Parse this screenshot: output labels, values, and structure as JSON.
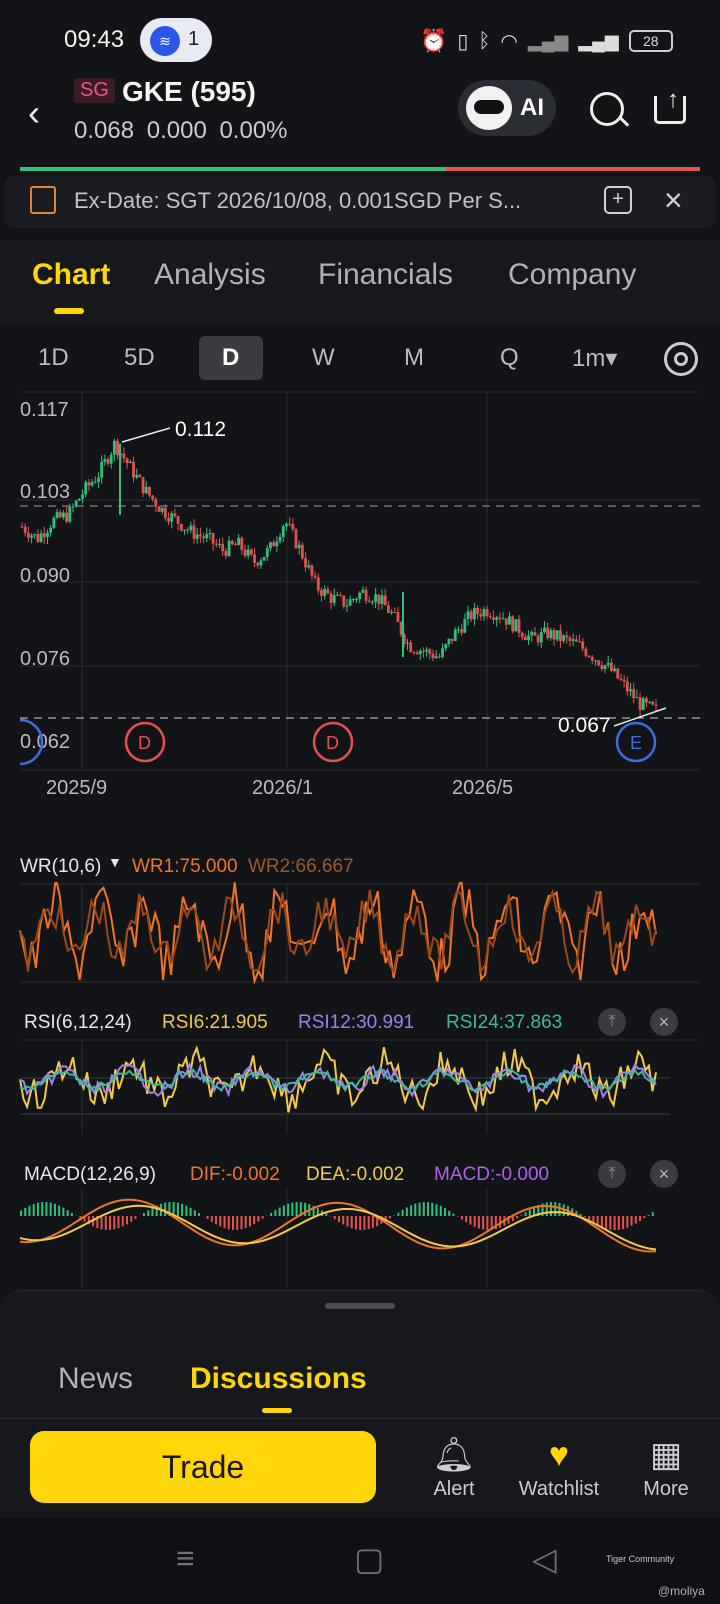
{
  "status": {
    "time": "09:43",
    "notif_count": "1",
    "battery": "28"
  },
  "header": {
    "market": "SG",
    "title": "GKE (595)",
    "quote": "0.068 0.000 0.00%",
    "ai_label": "AI"
  },
  "banner": {
    "text": "Ex-Date: SGT 2026/10/08, 0.001SGD Per S..."
  },
  "tabs": [
    "Chart",
    "Analysis",
    "Financials",
    "Company"
  ],
  "periods": [
    "1D",
    "5D",
    "D",
    "W",
    "M",
    "Q",
    "1m▾"
  ],
  "chart_data": {
    "type": "candlestick",
    "y_ticks": [
      "0.117",
      "0.103",
      "0.090",
      "0.076",
      "0.062"
    ],
    "x_ticks": [
      "2025/9",
      "2026/1",
      "2026/5"
    ],
    "high_label": "0.112",
    "low_label": "0.067",
    "markers": [
      "D",
      "D",
      "E"
    ],
    "price_path": [
      0.098,
      0.096,
      0.099,
      0.1,
      0.104,
      0.107,
      0.112,
      0.108,
      0.104,
      0.101,
      0.099,
      0.097,
      0.096,
      0.094,
      0.095,
      0.092,
      0.094,
      0.099,
      0.094,
      0.088,
      0.086,
      0.085,
      0.087,
      0.086,
      0.083,
      0.078,
      0.077,
      0.076,
      0.08,
      0.083,
      0.084,
      0.083,
      0.081,
      0.079,
      0.08,
      0.079,
      0.078,
      0.076,
      0.074,
      0.071,
      0.068,
      0.067
    ]
  },
  "indicators": {
    "wr": {
      "name": "WR(10,6)",
      "wr1": "WR1:75.000",
      "wr2": "WR2:66.667"
    },
    "rsi": {
      "name": "RSI(6,12,24)",
      "rsi6": "RSI6:21.905",
      "rsi12": "RSI12:30.991",
      "rsi24": "RSI24:37.863"
    },
    "macd": {
      "name": "MACD(12,26,9)",
      "dif": "DIF:-0.002",
      "dea": "DEA:-0.002",
      "macd": "MACD:-0.000"
    }
  },
  "bottom_tabs": {
    "news": "News",
    "discussions": "Discussions"
  },
  "actions": {
    "trade": "Trade",
    "alert": "Alert",
    "watchlist": "Watchlist",
    "more": "More"
  },
  "watermark": {
    "brand": "Tiger Community",
    "user": "@moliya"
  },
  "colors": {
    "accent": "#ffd60a",
    "up": "#2ec27e",
    "down": "#e2534f"
  }
}
